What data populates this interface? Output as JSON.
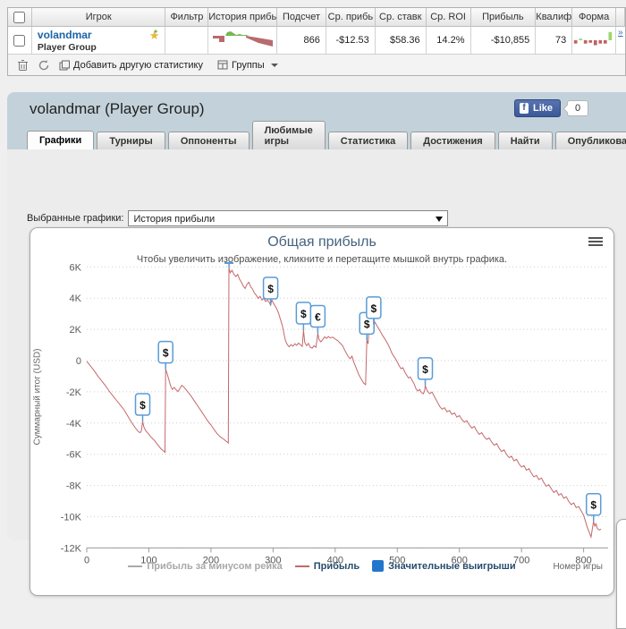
{
  "colors": {
    "link_blue": "#1b64a7",
    "negative_red": "#c86a6a",
    "line_red": "#c4676b",
    "marker_blue": "#5b9bd5",
    "legend_blue": "#2277cc",
    "panel_bg": "#c3d2da"
  },
  "table": {
    "headers": [
      "Игрок",
      "Фильтр",
      "История прибь",
      "Подсчет",
      "Ср. прибь",
      "Ср. ставк",
      "Ср. ROI",
      "Прибыль",
      "Квалиф",
      "Форма"
    ],
    "row": {
      "player": "volandmar",
      "group": "Player Group",
      "filter": "",
      "count": "866",
      "avg_profit": "-$12.53",
      "avg_stake": "$58.36",
      "avg_roi": "14.2%",
      "profit": "-$10,855",
      "qualif": "73",
      "more_link": "»",
      "sparkline": {
        "red_left": "3,8 16,8 16,15 10,15 10,11 3,11",
        "green": "17,8 19,4 23,3 26,5 29,7 33,6 36,7 40,7 44,8",
        "red_right": "40,8 46,9 52,10 58,11 64,12 70,13 70,20 62,18 54,16 47,13 40,10"
      },
      "form": [
        -4,
        2,
        -4,
        -3,
        -6,
        -4,
        -4,
        10
      ]
    },
    "toolbar": {
      "add_stat": "Добавить другую статистику",
      "groups": "Группы"
    }
  },
  "panel": {
    "title": "volandmar (Player Group)",
    "facebook": {
      "like_label": "Like",
      "count": "0"
    },
    "tabs": [
      "Графики",
      "Турниры",
      "Оппоненты",
      "Любимые игры",
      "Статистика",
      "Достижения",
      "Найти",
      "Опубликовать"
    ],
    "active_tab": "Графики",
    "select_label": "Выбранные графики:",
    "select_value": "История прибыли"
  },
  "chart_data": {
    "type": "line",
    "title": "Общая прибыль",
    "subtitle": "Чтобы увеличить изображение, кликните и перетащите мышкой внутрь графика.",
    "xlabel": "Номер игры",
    "ylabel": "Суммарный итог (USD)",
    "xlim": [
      0,
      838
    ],
    "ylim_thousands": [
      -12,
      6
    ],
    "grid": true,
    "legend_position": "bottom",
    "yticks": [
      "6K",
      "4K",
      "2K",
      "0",
      "-2K",
      "-4K",
      "-6K",
      "-8K",
      "-10K",
      "-12K"
    ],
    "ytick_values": [
      6,
      4,
      2,
      0,
      -2,
      -4,
      -6,
      -8,
      -10,
      -12
    ],
    "xticks": [
      0,
      100,
      200,
      300,
      400,
      500,
      600,
      700,
      800
    ],
    "legend": [
      {
        "label": "Прибыль за минусом рейка",
        "type": "line",
        "color": "#aaaaaa",
        "disabled": true
      },
      {
        "label": "Прибыль",
        "type": "line",
        "color": "#c4676b",
        "disabled": false
      },
      {
        "label": "Значительные выигрыши",
        "type": "square",
        "color": "#2277cc",
        "disabled": false
      }
    ],
    "markers": [
      {
        "x": 90,
        "y": -3.9,
        "label": "$"
      },
      {
        "x": 127,
        "y": -0.55,
        "label": "$"
      },
      {
        "x": 229,
        "y": 5.95,
        "label": "$",
        "clipped": true
      },
      {
        "x": 296,
        "y": 3.55,
        "label": "$"
      },
      {
        "x": 349,
        "y": 1.95,
        "label": "$"
      },
      {
        "x": 372,
        "y": 1.75,
        "label": "€"
      },
      {
        "x": 451,
        "y": 1.3,
        "label": "$"
      },
      {
        "x": 462,
        "y": 2.3,
        "label": "$"
      },
      {
        "x": 545,
        "y": -1.6,
        "label": "$"
      },
      {
        "x": 816,
        "y": -10.3,
        "label": "$"
      }
    ],
    "series": [
      {
        "name": "Прибыль",
        "color": "#c4676b",
        "data": [
          [
            0,
            -0.05
          ],
          [
            6,
            -0.35
          ],
          [
            12,
            -0.65
          ],
          [
            18,
            -1
          ],
          [
            24,
            -1.3
          ],
          [
            30,
            -1.6
          ],
          [
            36,
            -1.95
          ],
          [
            42,
            -2.25
          ],
          [
            48,
            -2.55
          ],
          [
            54,
            -2.85
          ],
          [
            60,
            -3.15
          ],
          [
            66,
            -3.55
          ],
          [
            72,
            -3.95
          ],
          [
            78,
            -4.3
          ],
          [
            83,
            -4.55
          ],
          [
            86,
            -4.62
          ],
          [
            88,
            -4.5
          ],
          [
            90,
            -3.9
          ],
          [
            92,
            -4.25
          ],
          [
            95,
            -4.5
          ],
          [
            99,
            -4.68
          ],
          [
            104,
            -4.92
          ],
          [
            109,
            -5.12
          ],
          [
            114,
            -5.38
          ],
          [
            119,
            -5.62
          ],
          [
            124,
            -5.8
          ],
          [
            126,
            -5.88
          ],
          [
            127,
            -0.55
          ],
          [
            129,
            -0.78
          ],
          [
            132,
            -1.2
          ],
          [
            135,
            -1.62
          ],
          [
            138,
            -1.85
          ],
          [
            141,
            -1.72
          ],
          [
            144,
            -1.88
          ],
          [
            147,
            -1.98
          ],
          [
            150,
            -1.78
          ],
          [
            153,
            -1.58
          ],
          [
            156,
            -1.68
          ],
          [
            159,
            -1.82
          ],
          [
            163,
            -2.02
          ],
          [
            167,
            -2.22
          ],
          [
            171,
            -2.45
          ],
          [
            175,
            -2.68
          ],
          [
            180,
            -2.98
          ],
          [
            185,
            -3.28
          ],
          [
            190,
            -3.58
          ],
          [
            195,
            -3.88
          ],
          [
            200,
            -4.12
          ],
          [
            205,
            -4.42
          ],
          [
            210,
            -4.68
          ],
          [
            215,
            -4.88
          ],
          [
            220,
            -5.02
          ],
          [
            224,
            -5.15
          ],
          [
            228,
            -5.28
          ],
          [
            229,
            5.95
          ],
          [
            231,
            5.62
          ],
          [
            234,
            5.78
          ],
          [
            237,
            5.52
          ],
          [
            240,
            5.38
          ],
          [
            243,
            5.52
          ],
          [
            246,
            5.22
          ],
          [
            249,
            5.02
          ],
          [
            252,
            4.78
          ],
          [
            255,
            4.62
          ],
          [
            258,
            4.88
          ],
          [
            261,
            5.02
          ],
          [
            264,
            4.72
          ],
          [
            267,
            4.58
          ],
          [
            270,
            4.32
          ],
          [
            273,
            4.18
          ],
          [
            276,
            3.98
          ],
          [
            279,
            4.12
          ],
          [
            282,
            3.88
          ],
          [
            285,
            3.98
          ],
          [
            288,
            3.78
          ],
          [
            291,
            3.88
          ],
          [
            294,
            3.72
          ],
          [
            296,
            3.55
          ],
          [
            298,
            3.88
          ],
          [
            300,
            3.72
          ],
          [
            303,
            3.52
          ],
          [
            306,
            3.32
          ],
          [
            309,
            3.02
          ],
          [
            312,
            2.62
          ],
          [
            315,
            2.22
          ],
          [
            318,
            1.62
          ],
          [
            320,
            1.28
          ],
          [
            323,
            1.02
          ],
          [
            326,
            0.88
          ],
          [
            329,
            1.02
          ],
          [
            332,
            0.92
          ],
          [
            335,
            1.08
          ],
          [
            338,
            0.98
          ],
          [
            341,
            1.12
          ],
          [
            344,
            1.02
          ],
          [
            347,
            0.9
          ],
          [
            349,
            1.95
          ],
          [
            351,
            1.15
          ],
          [
            354,
            0.95
          ],
          [
            357,
            1.1
          ],
          [
            360,
            0.85
          ],
          [
            363,
            0.8
          ],
          [
            366,
            0.95
          ],
          [
            369,
            0.85
          ],
          [
            372,
            1.75
          ],
          [
            374,
            1.35
          ],
          [
            377,
            1.2
          ],
          [
            380,
            1.35
          ],
          [
            383,
            1.52
          ],
          [
            386,
            1.42
          ],
          [
            389,
            1.55
          ],
          [
            392,
            1.45
          ],
          [
            396,
            1.5
          ],
          [
            400,
            1.38
          ],
          [
            404,
            1.28
          ],
          [
            408,
            1.12
          ],
          [
            412,
            0.95
          ],
          [
            416,
            0.62
          ],
          [
            420,
            0.32
          ],
          [
            424,
            0.12
          ],
          [
            427,
            0.28
          ],
          [
            430,
            -0.1
          ],
          [
            434,
            -0.5
          ],
          [
            438,
            -0.9
          ],
          [
            442,
            -1.2
          ],
          [
            446,
            -1.45
          ],
          [
            449,
            -1.55
          ],
          [
            451,
            1.3
          ],
          [
            453,
            1.08
          ],
          [
            455,
            2.35
          ],
          [
            457,
            2.12
          ],
          [
            459,
            2.38
          ],
          [
            462,
            2.3
          ],
          [
            464,
            2.45
          ],
          [
            467,
            2.25
          ],
          [
            470,
            2.05
          ],
          [
            473,
            1.85
          ],
          [
            476,
            1.62
          ],
          [
            479,
            1.45
          ],
          [
            482,
            1.25
          ],
          [
            485,
            1.05
          ],
          [
            488,
            0.8
          ],
          [
            491,
            0.5
          ],
          [
            494,
            0.3
          ],
          [
            497,
            0.12
          ],
          [
            500,
            -0.1
          ],
          [
            503,
            -0.32
          ],
          [
            506,
            -0.52
          ],
          [
            509,
            -0.45
          ],
          [
            512,
            -0.72
          ],
          [
            515,
            -0.92
          ],
          [
            518,
            -1.12
          ],
          [
            521,
            -1.05
          ],
          [
            524,
            -1.28
          ],
          [
            527,
            -1.48
          ],
          [
            530,
            -1.8
          ],
          [
            533,
            -1.95
          ],
          [
            536,
            -1.85
          ],
          [
            539,
            -2.05
          ],
          [
            542,
            -2.12
          ],
          [
            544,
            -1.95
          ],
          [
            545,
            -1.6
          ],
          [
            548,
            -1.92
          ],
          [
            552,
            -2.12
          ],
          [
            556,
            -2.02
          ],
          [
            560,
            -2.32
          ],
          [
            564,
            -2.62
          ],
          [
            568,
            -2.92
          ],
          [
            572,
            -3.12
          ],
          [
            576,
            -3.02
          ],
          [
            580,
            -3.28
          ],
          [
            584,
            -3.2
          ],
          [
            588,
            -3.45
          ],
          [
            592,
            -3.35
          ],
          [
            596,
            -3.62
          ],
          [
            600,
            -3.52
          ],
          [
            604,
            -3.78
          ],
          [
            608,
            -3.95
          ],
          [
            612,
            -3.85
          ],
          [
            616,
            -4.12
          ],
          [
            620,
            -4.32
          ],
          [
            624,
            -4.22
          ],
          [
            628,
            -4.52
          ],
          [
            632,
            -4.72
          ],
          [
            636,
            -4.62
          ],
          [
            640,
            -4.88
          ],
          [
            644,
            -5.05
          ],
          [
            648,
            -4.95
          ],
          [
            652,
            -5.22
          ],
          [
            656,
            -5.42
          ],
          [
            660,
            -5.32
          ],
          [
            664,
            -5.62
          ],
          [
            668,
            -5.82
          ],
          [
            672,
            -5.72
          ],
          [
            676,
            -6.02
          ],
          [
            680,
            -6.22
          ],
          [
            684,
            -6.12
          ],
          [
            688,
            -6.42
          ],
          [
            692,
            -6.32
          ],
          [
            696,
            -6.62
          ],
          [
            700,
            -6.82
          ],
          [
            704,
            -6.72
          ],
          [
            708,
            -7.02
          ],
          [
            712,
            -6.92
          ],
          [
            716,
            -7.22
          ],
          [
            720,
            -7.45
          ],
          [
            724,
            -7.35
          ],
          [
            728,
            -7.62
          ],
          [
            732,
            -7.52
          ],
          [
            736,
            -7.82
          ],
          [
            740,
            -8.05
          ],
          [
            744,
            -7.95
          ],
          [
            748,
            -8.22
          ],
          [
            752,
            -8.45
          ],
          [
            756,
            -8.32
          ],
          [
            760,
            -8.62
          ],
          [
            764,
            -8.52
          ],
          [
            768,
            -8.82
          ],
          [
            772,
            -8.72
          ],
          [
            776,
            -9.02
          ],
          [
            780,
            -9.22
          ],
          [
            784,
            -9.12
          ],
          [
            788,
            -9.42
          ],
          [
            792,
            -9.35
          ],
          [
            796,
            -9.62
          ],
          [
            800,
            -9.9
          ],
          [
            803,
            -10.3
          ],
          [
            806,
            -10.7
          ],
          [
            809,
            -11.0
          ],
          [
            812,
            -11.3
          ],
          [
            816,
            -10.3
          ],
          [
            818,
            -10.6
          ],
          [
            820,
            -10.45
          ],
          [
            822,
            -10.75
          ],
          [
            825,
            -10.85
          ],
          [
            828,
            -10.8
          ]
        ]
      }
    ]
  }
}
